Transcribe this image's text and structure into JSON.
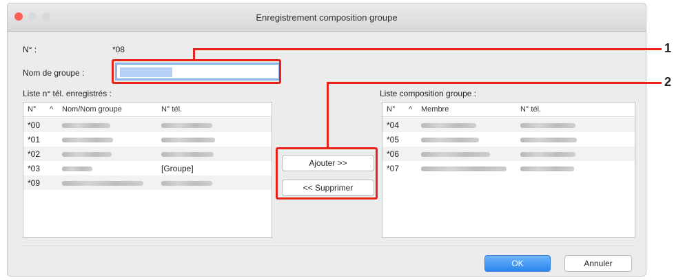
{
  "window": {
    "title": "Enregistrement composition groupe"
  },
  "number": {
    "label": "N° :",
    "value": "*08"
  },
  "group_name": {
    "label": "Nom de groupe :"
  },
  "registered": {
    "title": "Liste n° tél. enregistrés :",
    "columns": [
      "N°",
      "Nom/Nom groupe",
      "N° tél."
    ],
    "rows": [
      {
        "no": "*00"
      },
      {
        "no": "*01"
      },
      {
        "no": "*02"
      },
      {
        "no": "*03",
        "tel": "[Groupe]"
      },
      {
        "no": "*09"
      }
    ]
  },
  "members": {
    "title": "Liste composition groupe :",
    "columns": [
      "N°",
      "Membre",
      "N° tél."
    ],
    "rows": [
      {
        "no": "*04"
      },
      {
        "no": "*05"
      },
      {
        "no": "*06"
      },
      {
        "no": "*07"
      }
    ]
  },
  "buttons": {
    "add": "Ajouter >>",
    "remove": "<< Supprimer",
    "ok": "OK",
    "cancel": "Annuler"
  },
  "callouts": [
    "1",
    "2"
  ],
  "colors": {
    "highlight": "#e8231c",
    "accent": "#2a86f0"
  }
}
